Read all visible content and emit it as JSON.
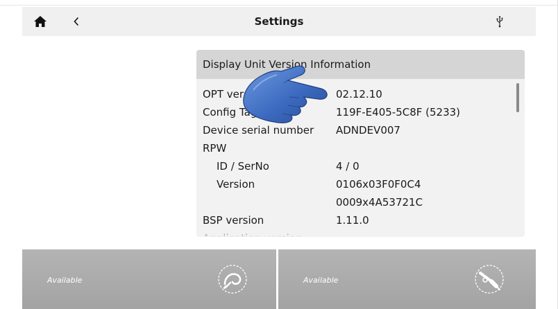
{
  "header": {
    "title": "Settings",
    "home_icon": "home-icon",
    "back_icon": "chevron-left-icon",
    "usb_icon": "usb-icon"
  },
  "panel": {
    "title": "Display Unit Version Information",
    "rows": [
      {
        "label": "OPT version",
        "value": "02.12.10",
        "indent": false
      },
      {
        "label": "Config Tag",
        "value": "119F-E405-5C8F (5233)",
        "indent": false
      },
      {
        "label": "Device serial number",
        "value": "ADNDEV007",
        "indent": false
      },
      {
        "label": "RPW",
        "value": "",
        "indent": false
      },
      {
        "label": "ID / SerNo",
        "value": "4 / 0",
        "indent": true
      },
      {
        "label": "Version",
        "value": "0106x03F0F0C4",
        "indent": true
      },
      {
        "label": "",
        "value": "0009x4A53721C",
        "indent": true
      },
      {
        "label": "BSP version",
        "value": "1.11.0",
        "indent": false
      },
      {
        "label": "Application version",
        "value": "",
        "indent": false
      }
    ]
  },
  "tiles": [
    {
      "label": "Available",
      "icon": "attachment-hook-icon"
    },
    {
      "label": "Available",
      "icon": "attachment-torch-icon"
    }
  ],
  "colors": {
    "topbar_bg": "#f0f0f0",
    "panel_bg": "#f2f2f2",
    "panel_header_bg": "#d5d5d5",
    "tile_bg": "#a9a9a9",
    "hand_blue": "#4a78c8"
  }
}
